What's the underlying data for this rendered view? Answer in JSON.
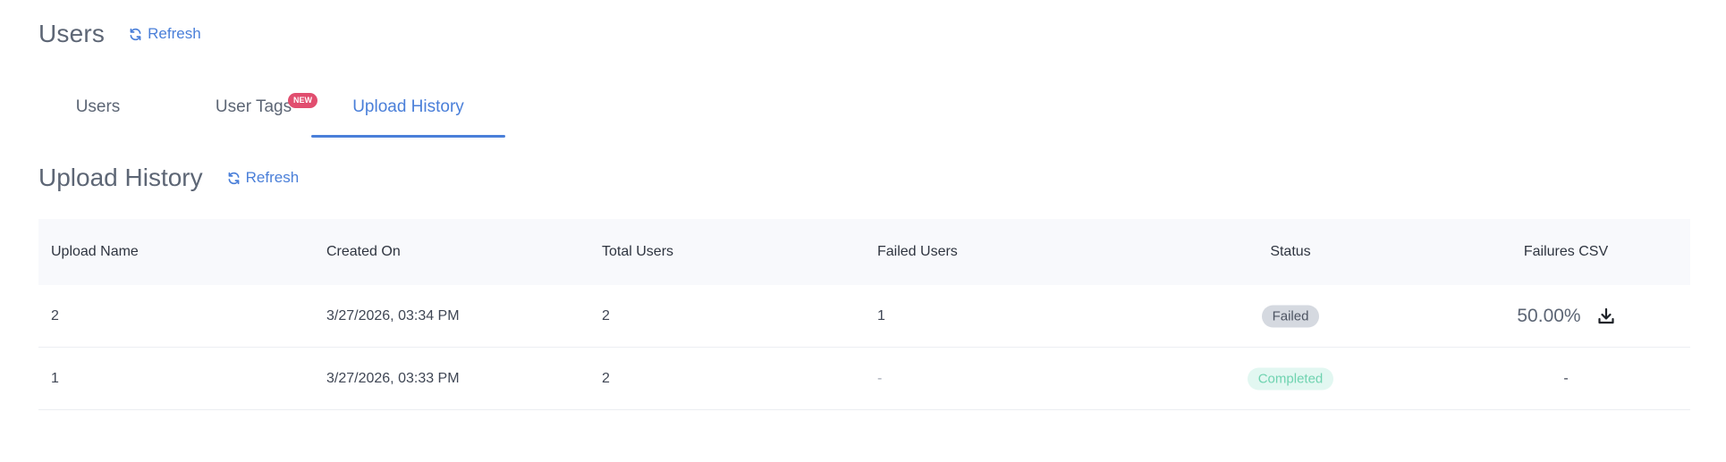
{
  "header": {
    "title": "Users",
    "refresh_label": "Refresh"
  },
  "tabs": [
    {
      "label": "Users",
      "active": false
    },
    {
      "label": "User Tags",
      "active": false,
      "badge": "NEW"
    },
    {
      "label": "Upload History",
      "active": true
    }
  ],
  "section": {
    "title": "Upload History",
    "refresh_label": "Refresh"
  },
  "table": {
    "columns": [
      "Upload Name",
      "Created On",
      "Total Users",
      "Failed Users",
      "Status",
      "Failures CSV"
    ],
    "rows": [
      {
        "upload_name": "2",
        "created_on": "3/27/2026, 03:34 PM",
        "total_users": "2",
        "failed_users": "1",
        "status": "Failed",
        "failures_csv": "50.00%"
      },
      {
        "upload_name": "1",
        "created_on": "3/27/2026, 03:33 PM",
        "total_users": "2",
        "failed_users": "-",
        "status": "Completed",
        "failures_csv": "-"
      }
    ]
  },
  "colors": {
    "accent": "#4a7fd9",
    "badge_new": "#e14e6f",
    "status_failed_bg": "#d5d9e0",
    "status_completed_bg": "#e2f7f1",
    "status_completed_text": "#6fd3b0"
  },
  "icons": {
    "refresh": "refresh-icon",
    "download": "download-icon"
  }
}
